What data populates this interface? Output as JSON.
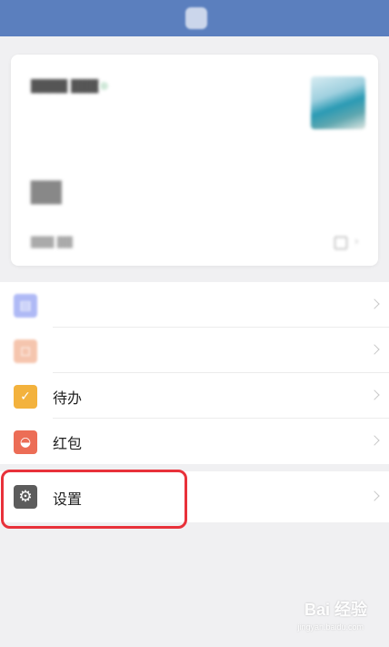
{
  "colors": {
    "topbar": "#5b7fbe",
    "highlight": "#e8313a",
    "doc_icon": "#7b8cf0",
    "fav_icon": "#f0a07a",
    "todo_icon": "#f3b23d",
    "redpacket_icon": "#ec6d56",
    "settings_icon": "#5c5c5c"
  },
  "menu": {
    "items": [
      {
        "label": "",
        "icon": "document-icon",
        "color": "#7b8cf0",
        "faded": true
      },
      {
        "label": "",
        "icon": "favorite-icon",
        "color": "#f0a07a",
        "faded": true
      },
      {
        "label": "待办",
        "icon": "todo-check-icon",
        "color": "#f3b23d",
        "faded": false
      },
      {
        "label": "红包",
        "icon": "red-packet-icon",
        "color": "#ec6d56",
        "faded": false
      }
    ],
    "settings": {
      "label": "设置",
      "icon": "gear-icon"
    }
  },
  "watermark": {
    "text": "Bai 经验",
    "sub": "jingyan.baidu.com"
  }
}
